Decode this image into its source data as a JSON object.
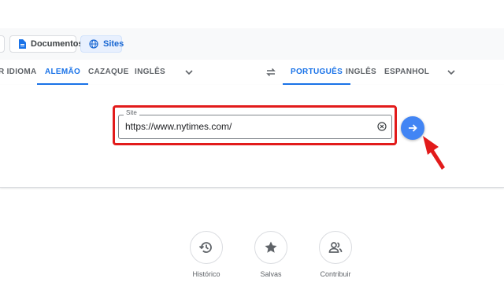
{
  "modes": {
    "documents_label": "Documentos",
    "sites_label": "Sites"
  },
  "source_languages": [
    {
      "label": "R IDIOMA",
      "active": false
    },
    {
      "label": "ALEMÃO",
      "active": true
    },
    {
      "label": "CAZAQUE",
      "active": false
    },
    {
      "label": "INGLÊS",
      "active": false
    }
  ],
  "target_languages": [
    {
      "label": "PORTUGUÊS",
      "active": true
    },
    {
      "label": "INGLÊS",
      "active": false
    },
    {
      "label": "ESPANHOL",
      "active": false
    }
  ],
  "site_input": {
    "label": "Site",
    "value": "https://www.nytimes.com/"
  },
  "shortcuts": [
    {
      "label": "Histórico",
      "icon": "history-icon"
    },
    {
      "label": "Salvas",
      "icon": "star-icon"
    },
    {
      "label": "Contribuir",
      "icon": "people-icon"
    }
  ],
  "colors": {
    "accent": "#1a73e8",
    "go_button": "#4285f4",
    "annotation_red": "#e21b1b"
  }
}
